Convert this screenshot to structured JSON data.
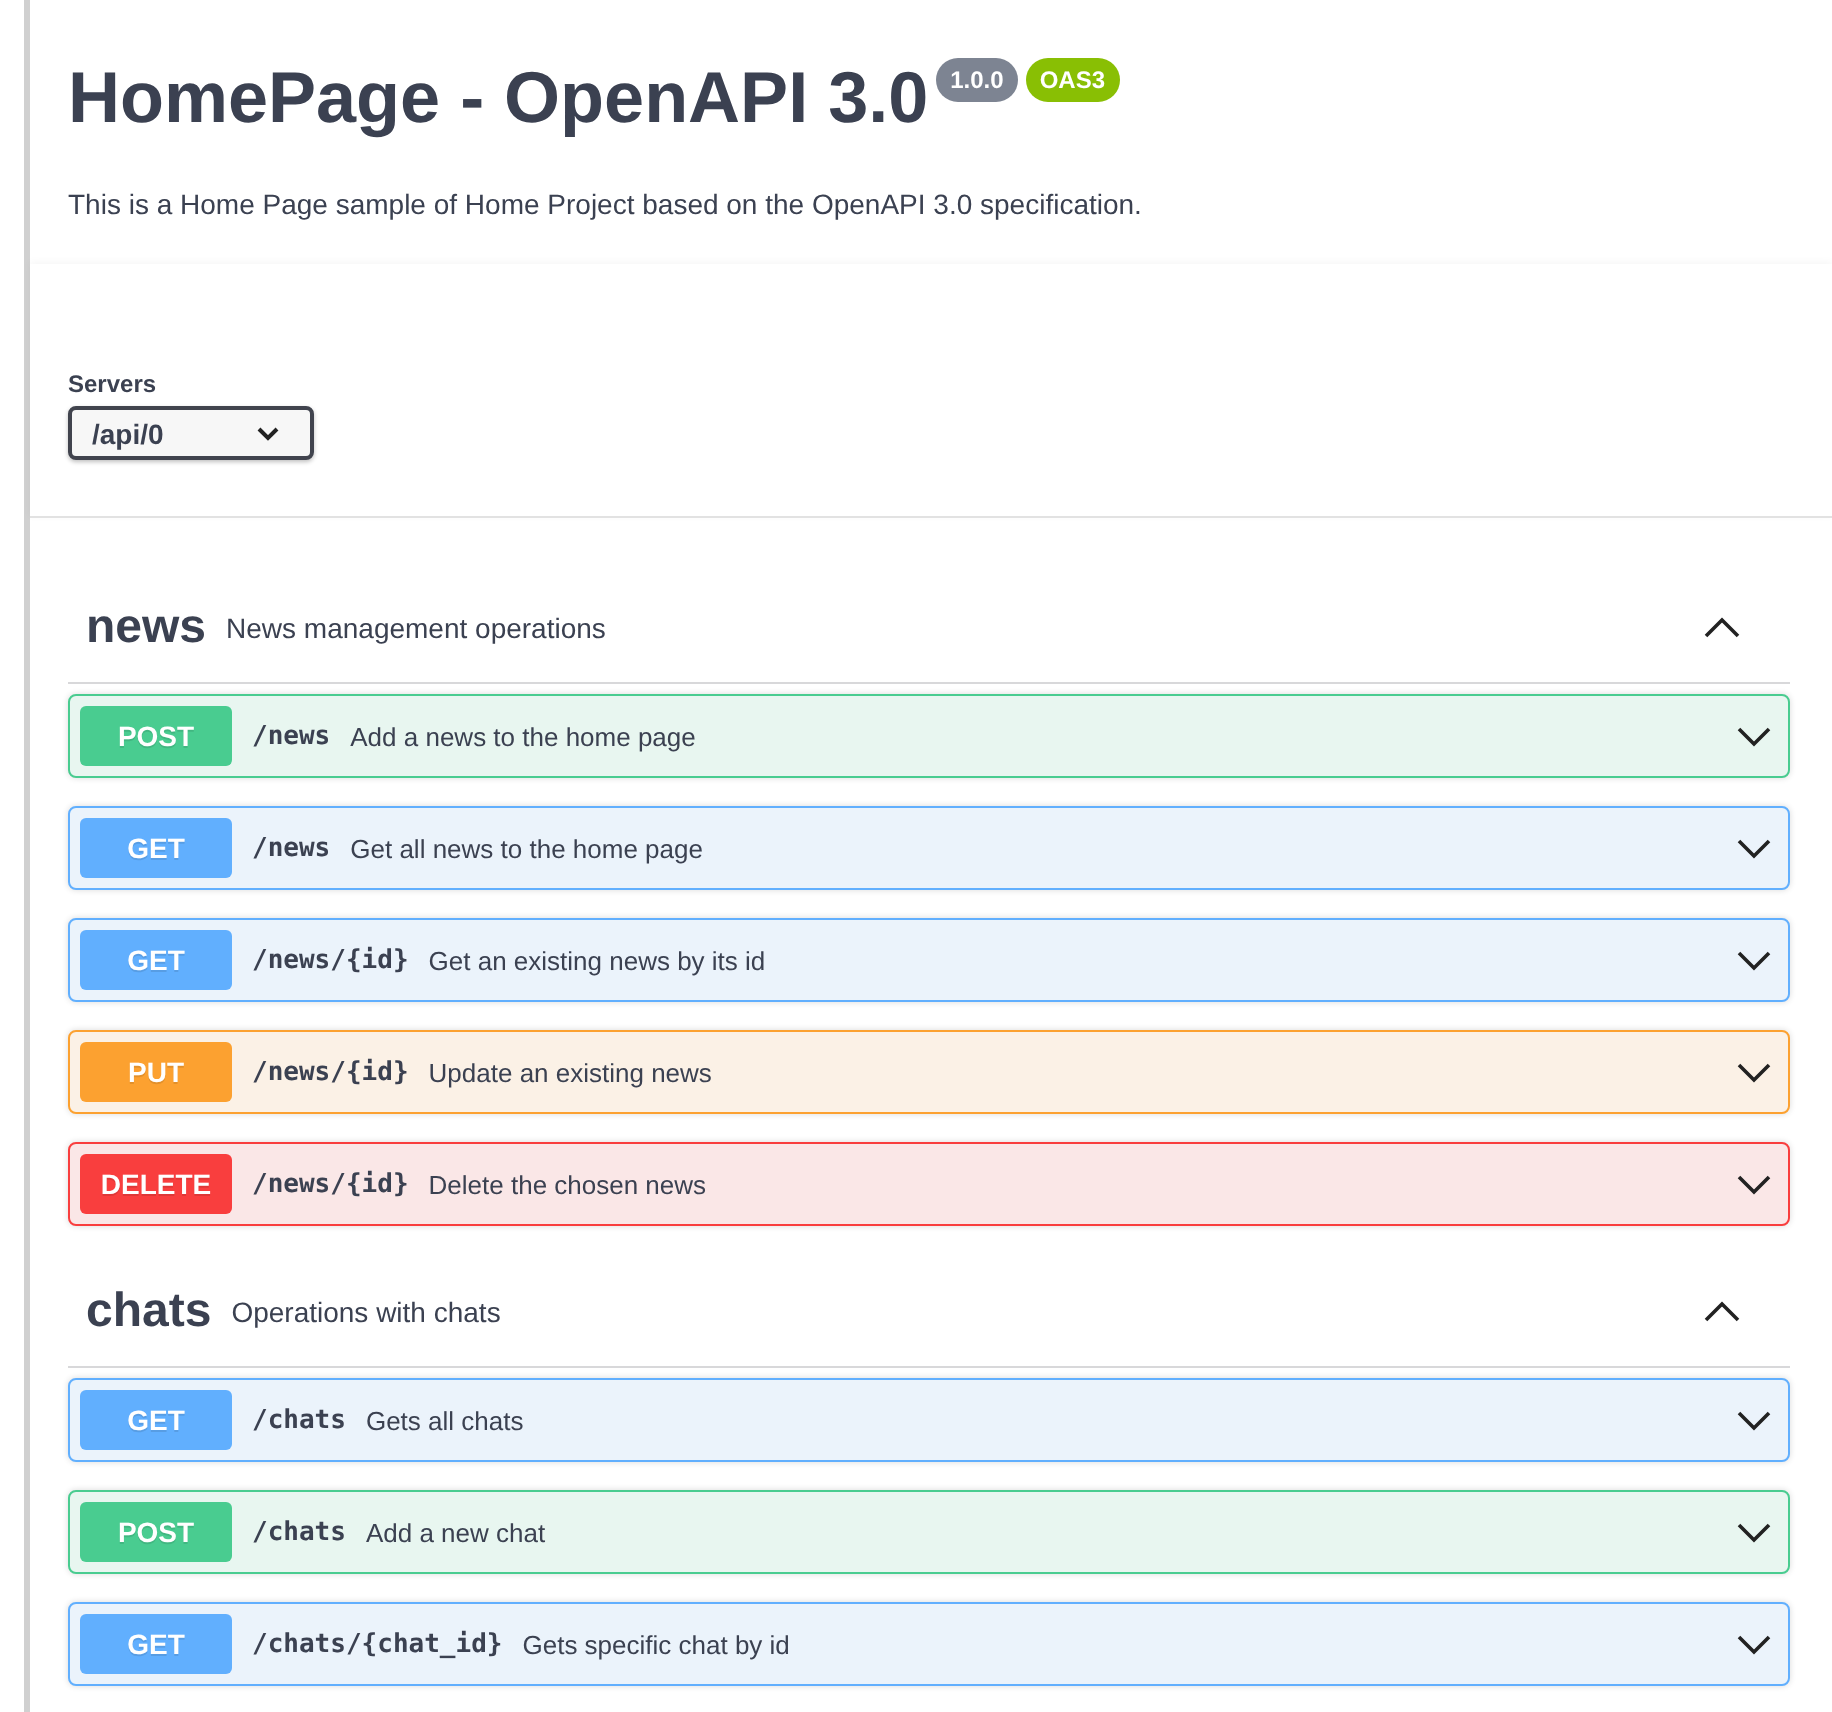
{
  "info": {
    "title": "HomePage - OpenAPI 3.0",
    "version": "1.0.0",
    "spec_badge": "OAS3",
    "description": "This is a Home Page sample of Home Project based on the OpenAPI 3.0 specification."
  },
  "servers": {
    "label": "Servers",
    "value": "/api/0"
  },
  "tags": [
    {
      "name": "news",
      "description": "News management operations",
      "expanded": true,
      "operations": [
        {
          "kind": "post",
          "method": "POST",
          "path": "/news",
          "summary": "Add a news to the home page",
          "expanded": false
        },
        {
          "kind": "get",
          "method": "GET",
          "path": "/news",
          "summary": "Get all news to the home page",
          "expanded": false
        },
        {
          "kind": "get",
          "method": "GET",
          "path": "/news/{id}",
          "summary": "Get an existing news by its id",
          "expanded": false
        },
        {
          "kind": "put",
          "method": "PUT",
          "path": "/news/{id}",
          "summary": "Update an existing news",
          "expanded": false
        },
        {
          "kind": "delete",
          "method": "DELETE",
          "path": "/news/{id}",
          "summary": "Delete the chosen news",
          "expanded": false
        }
      ]
    },
    {
      "name": "chats",
      "description": "Operations with chats",
      "expanded": true,
      "operations": [
        {
          "kind": "get",
          "method": "GET",
          "path": "/chats",
          "summary": "Gets all chats",
          "expanded": false
        },
        {
          "kind": "post",
          "method": "POST",
          "path": "/chats",
          "summary": "Add a new chat",
          "expanded": false
        },
        {
          "kind": "get",
          "method": "GET",
          "path": "/chats/{chat_id}",
          "summary": "Gets specific chat by id",
          "expanded": false
        }
      ]
    }
  ]
}
